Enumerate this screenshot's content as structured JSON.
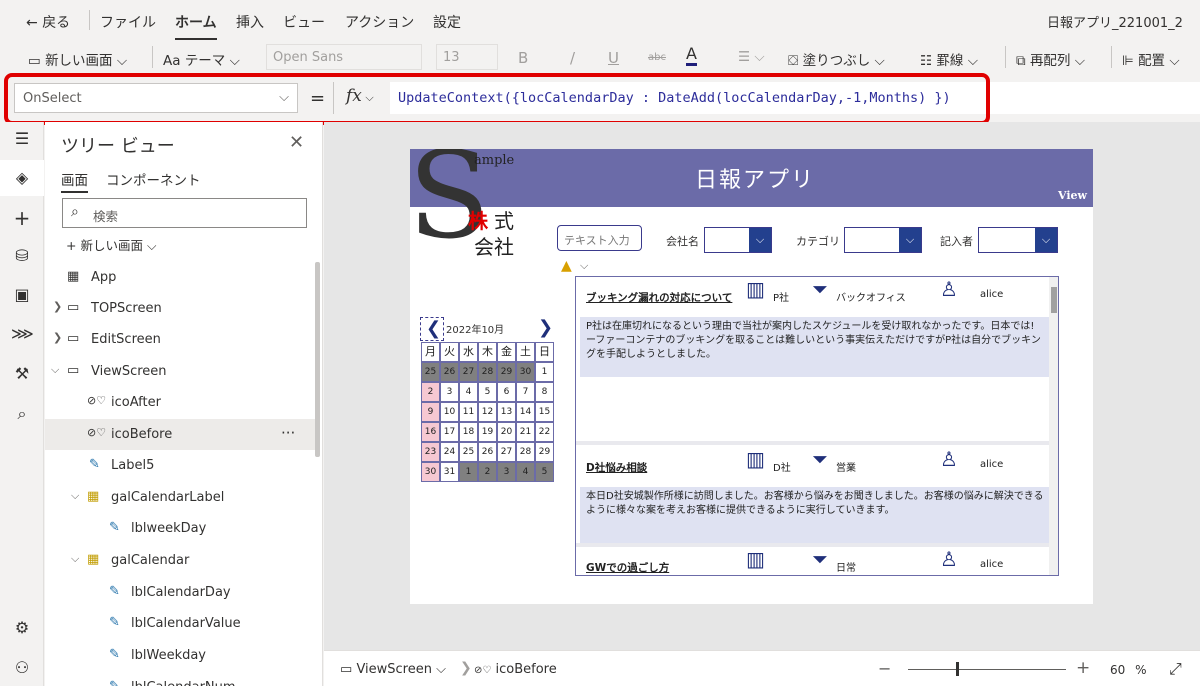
{
  "menubar": {
    "back": "戻る",
    "items": [
      "ファイル",
      "ホーム",
      "挿入",
      "ビュー",
      "アクション",
      "設定"
    ],
    "active": "ホーム",
    "app_title": "日報アプリ_221001_2"
  },
  "toolbar": {
    "new_screen": "新しい画面",
    "theme": "テーマ",
    "font": "Open Sans",
    "font_size": "13",
    "bold": "B",
    "italic": "/",
    "underline": "U",
    "strike": "abc",
    "font_color": "A",
    "fill": "塗りつぶし",
    "border": "罫線",
    "reorder": "再配列",
    "align": "配置"
  },
  "formulabar": {
    "property": "OnSelect",
    "equals": "=",
    "fx": "fx",
    "formula": "UpdateContext({locCalendarDay : DateAdd(locCalendarDay,-1,Months) })"
  },
  "tree": {
    "title": "ツリー ビュー",
    "tabs": [
      "画面",
      "コンポーネント"
    ],
    "search_placeholder": "検索",
    "new_screen": "新しい画面",
    "items": [
      {
        "label": "App"
      },
      {
        "label": "TOPScreen"
      },
      {
        "label": "EditScreen"
      },
      {
        "label": "ViewScreen"
      },
      {
        "label": "icoAfter"
      },
      {
        "label": "icoBefore"
      },
      {
        "label": "Label5"
      },
      {
        "label": "galCalendarLabel"
      },
      {
        "label": "lblweekDay"
      },
      {
        "label": "galCalendar"
      },
      {
        "label": "lblCalendarDay"
      },
      {
        "label": "lblCalendarValue"
      },
      {
        "label": "lblWeekday"
      },
      {
        "label": "lblCalendarNum"
      }
    ],
    "more": "···"
  },
  "app": {
    "header_title": "日報アプリ",
    "header_view": "View",
    "logo_sample": "ample",
    "logo_kabu": "株",
    "logo_shiki": "式",
    "logo_kaisha": "会社",
    "text_input_placeholder": "テキスト入力",
    "filter_company": "会社名",
    "filter_category": "カテゴリ",
    "filter_author": "記入者",
    "calendar": {
      "month_label": "2022年10月",
      "weekdays": [
        "月",
        "火",
        "水",
        "木",
        "金",
        "土",
        "日"
      ],
      "rows": [
        [
          "25",
          "26",
          "27",
          "28",
          "29",
          "30",
          "1"
        ],
        [
          "2",
          "3",
          "4",
          "5",
          "6",
          "7",
          "8"
        ],
        [
          "9",
          "10",
          "11",
          "12",
          "13",
          "14",
          "15"
        ],
        [
          "16",
          "17",
          "18",
          "19",
          "20",
          "21",
          "22"
        ],
        [
          "23",
          "24",
          "25",
          "26",
          "27",
          "28",
          "29"
        ],
        [
          "30",
          "31",
          "1",
          "2",
          "3",
          "4",
          "5"
        ]
      ]
    },
    "cards": [
      {
        "title": "ブッキング漏れの対応について",
        "company": "P社",
        "category": "バックオフィス",
        "user": "alice",
        "body": "P社は在庫切れになるという理由で当社が案内したスケジュールを受け取れなかったです。日本では!ーファーコンテナのブッキングを取ることは難しいという事実伝えただけですがP社は自分でブッキングを手配しようとしました。"
      },
      {
        "title": "D社悩み相談",
        "company": "D社",
        "category": "営業",
        "user": "alice",
        "body": "本日D社安城製作所様に訪問しました。お客様から悩みをお聞きしました。お客様の悩みに解決できるように様々な案を考えお客様に提供できるように実行していきます。"
      },
      {
        "title": "GWでの過ごし方",
        "company": "",
        "category": "日常",
        "user": "alice",
        "body": ""
      }
    ]
  },
  "statusbar": {
    "screen": "ViewScreen",
    "selected": "icoBefore",
    "minus": "−",
    "plus": "+",
    "zoom": "60",
    "zoom_unit": "%"
  },
  "colors": {
    "accent": "#6b6ba8",
    "highlight": "#e00000",
    "dropdown": "#23408e"
  }
}
